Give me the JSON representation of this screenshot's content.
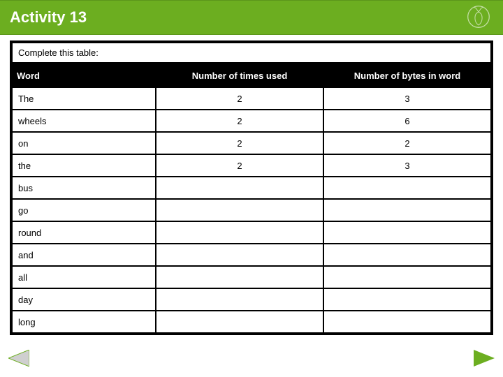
{
  "header": {
    "title": "Activity 13"
  },
  "instruction": "Complete this table:",
  "table": {
    "headers": {
      "word": "Word",
      "times": "Number of times used",
      "bytes": "Number of bytes in word"
    },
    "rows": [
      {
        "word": "The",
        "times": "2",
        "bytes": "3"
      },
      {
        "word": "wheels",
        "times": "2",
        "bytes": "6"
      },
      {
        "word": "on",
        "times": "2",
        "bytes": "2"
      },
      {
        "word": "the",
        "times": "2",
        "bytes": "3"
      },
      {
        "word": "bus",
        "times": "",
        "bytes": ""
      },
      {
        "word": "go",
        "times": "",
        "bytes": ""
      },
      {
        "word": "round",
        "times": "",
        "bytes": ""
      },
      {
        "word": "and",
        "times": "",
        "bytes": ""
      },
      {
        "word": "all",
        "times": "",
        "bytes": ""
      },
      {
        "word": "day",
        "times": "",
        "bytes": ""
      },
      {
        "word": "long",
        "times": "",
        "bytes": ""
      }
    ]
  },
  "icons": {
    "logo": "deer-logo-icon",
    "prev": "prev-slide-icon",
    "next": "next-slide-icon"
  },
  "colors": {
    "accent": "#6cae20",
    "frame": "#000000"
  }
}
